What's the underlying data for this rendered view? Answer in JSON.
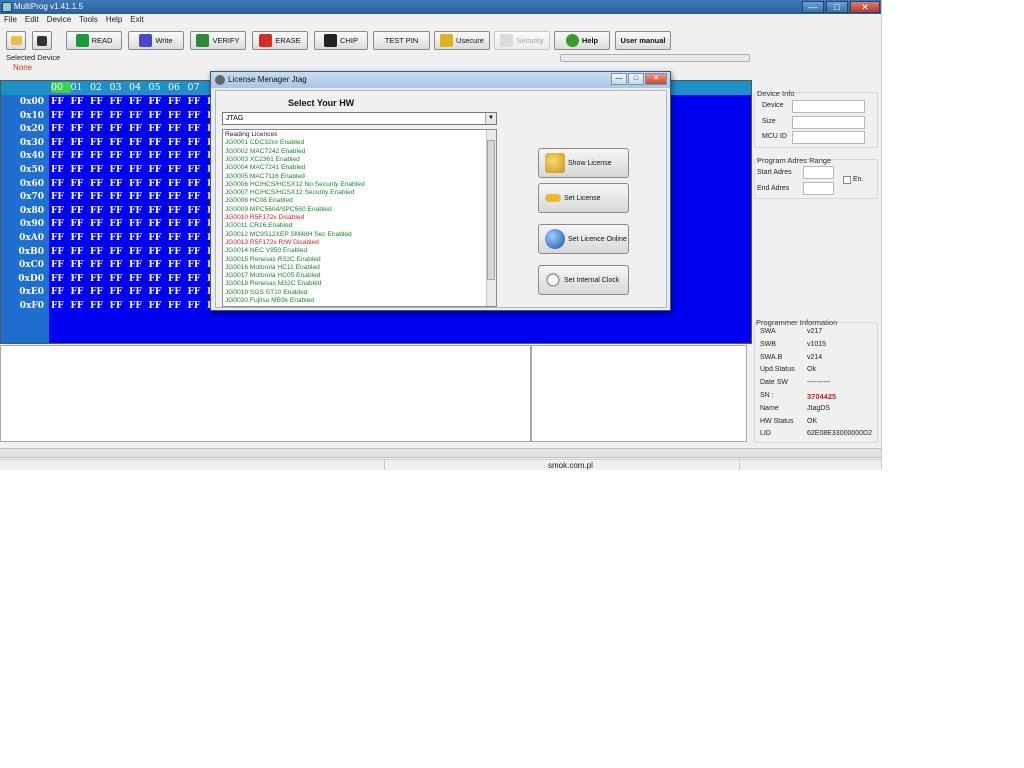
{
  "window": {
    "title": "MultiProg v1.41.1.5",
    "min": "—",
    "max": "□",
    "close": "✕"
  },
  "menu": [
    "File",
    "Edit",
    "Device",
    "Tools",
    "Help",
    "Exit"
  ],
  "toolbar": {
    "read": "READ",
    "write": "Write",
    "verify": "VERIFY",
    "erase": "ERASE",
    "chip": "CHIP",
    "test_pin": "TEST PIN",
    "usecure": "Usecure",
    "security": "Security",
    "help": "Help",
    "user_manual": "User manual"
  },
  "selected_device": {
    "label": "Selected Device",
    "value": "None"
  },
  "hex": {
    "columns": [
      "00",
      "01",
      "02",
      "03",
      "04",
      "05",
      "06",
      "07"
    ],
    "rows": [
      "0x00",
      "0x10",
      "0x20",
      "0x30",
      "0x40",
      "0x50",
      "0x60",
      "0x70",
      "0x80",
      "0x90",
      "0xA0",
      "0xB0",
      "0xC0",
      "0xD0",
      "0xE0",
      "0xF0"
    ],
    "cell": "FF",
    "tail": "F"
  },
  "device_info": {
    "title": "Device Info",
    "device": "Device",
    "size": "Size",
    "mcu_id": "MCU ID"
  },
  "program_range": {
    "title": "Program Adres Range",
    "start": "Start Adres",
    "end": "End Adres",
    "en": "En."
  },
  "programmer_info": {
    "title": "Programmer Information",
    "rows": [
      {
        "label": "SWA",
        "value": "v217"
      },
      {
        "label": "SWB",
        "value": "v1015"
      },
      {
        "label": "SWA.B",
        "value": "v214"
      },
      {
        "label": "Upd.Status",
        "value": "Ok"
      },
      {
        "label": "Date  SW",
        "value": "----------"
      },
      {
        "label": "SN :",
        "value": "3704425"
      },
      {
        "label": "Name",
        "value": "JtagDS"
      },
      {
        "label": "HW Status",
        "value": "OK"
      },
      {
        "label": "LID",
        "value": "62E08E33000000D2"
      }
    ]
  },
  "status": {
    "site": "smok.com.pl"
  },
  "dialog": {
    "title": "License Menager Jtag",
    "heading": "Select Your HW",
    "selected_hw": "JTAG",
    "licences": [
      {
        "text": "Reading Licences",
        "state": "black"
      },
      {
        "text": "JG0001 CDC32xx Enabled",
        "state": "green"
      },
      {
        "text": "JG0002 MAC7242 Enabled",
        "state": "green"
      },
      {
        "text": "JG0003 XC2361 Enabled",
        "state": "green"
      },
      {
        "text": "JG0004 MAC7241 Enabled",
        "state": "green"
      },
      {
        "text": "JG0005 MAC7116 Enabled",
        "state": "green"
      },
      {
        "text": "JG0006 HC/HCS/HCSX12 No Security Enabled",
        "state": "green"
      },
      {
        "text": "JG0007 HC/HCS/HCSX12 Security Enabled",
        "state": "green"
      },
      {
        "text": "JG0008 HC08 Enabled",
        "state": "green"
      },
      {
        "text": "JG0009 MPC5604/SPC560 Enabled",
        "state": "green"
      },
      {
        "text": "JG0010 R5F172x Disabled",
        "state": "red"
      },
      {
        "text": "JG0011 CR16 Enabled",
        "state": "green"
      },
      {
        "text": "JG0012 MC9S12XEP SM48H Sec Enabled",
        "state": "green"
      },
      {
        "text": "JG0013 R5F172x R/W Disabled",
        "state": "red"
      },
      {
        "text": "JG0014 NEC V850 Enabled",
        "state": "green"
      },
      {
        "text": "JG0015 Renesas R32C Enabled",
        "state": "green"
      },
      {
        "text": "JG0016 Motorola HC11 Enabled",
        "state": "green"
      },
      {
        "text": "JG0017 Motorola HC05 Enabled",
        "state": "green"
      },
      {
        "text": "JG0018 Renesas M32C Enabled",
        "state": "green"
      },
      {
        "text": "JG0019 SGS ST10  Enabled",
        "state": "green"
      },
      {
        "text": "JG0020 Fujitsu MB9x  Enabled",
        "state": "green"
      }
    ],
    "buttons": {
      "show_license": "Show License",
      "set_license": "Set License",
      "set_online": "Set Licence Online",
      "set_clock": "Set Internal Clock"
    }
  }
}
